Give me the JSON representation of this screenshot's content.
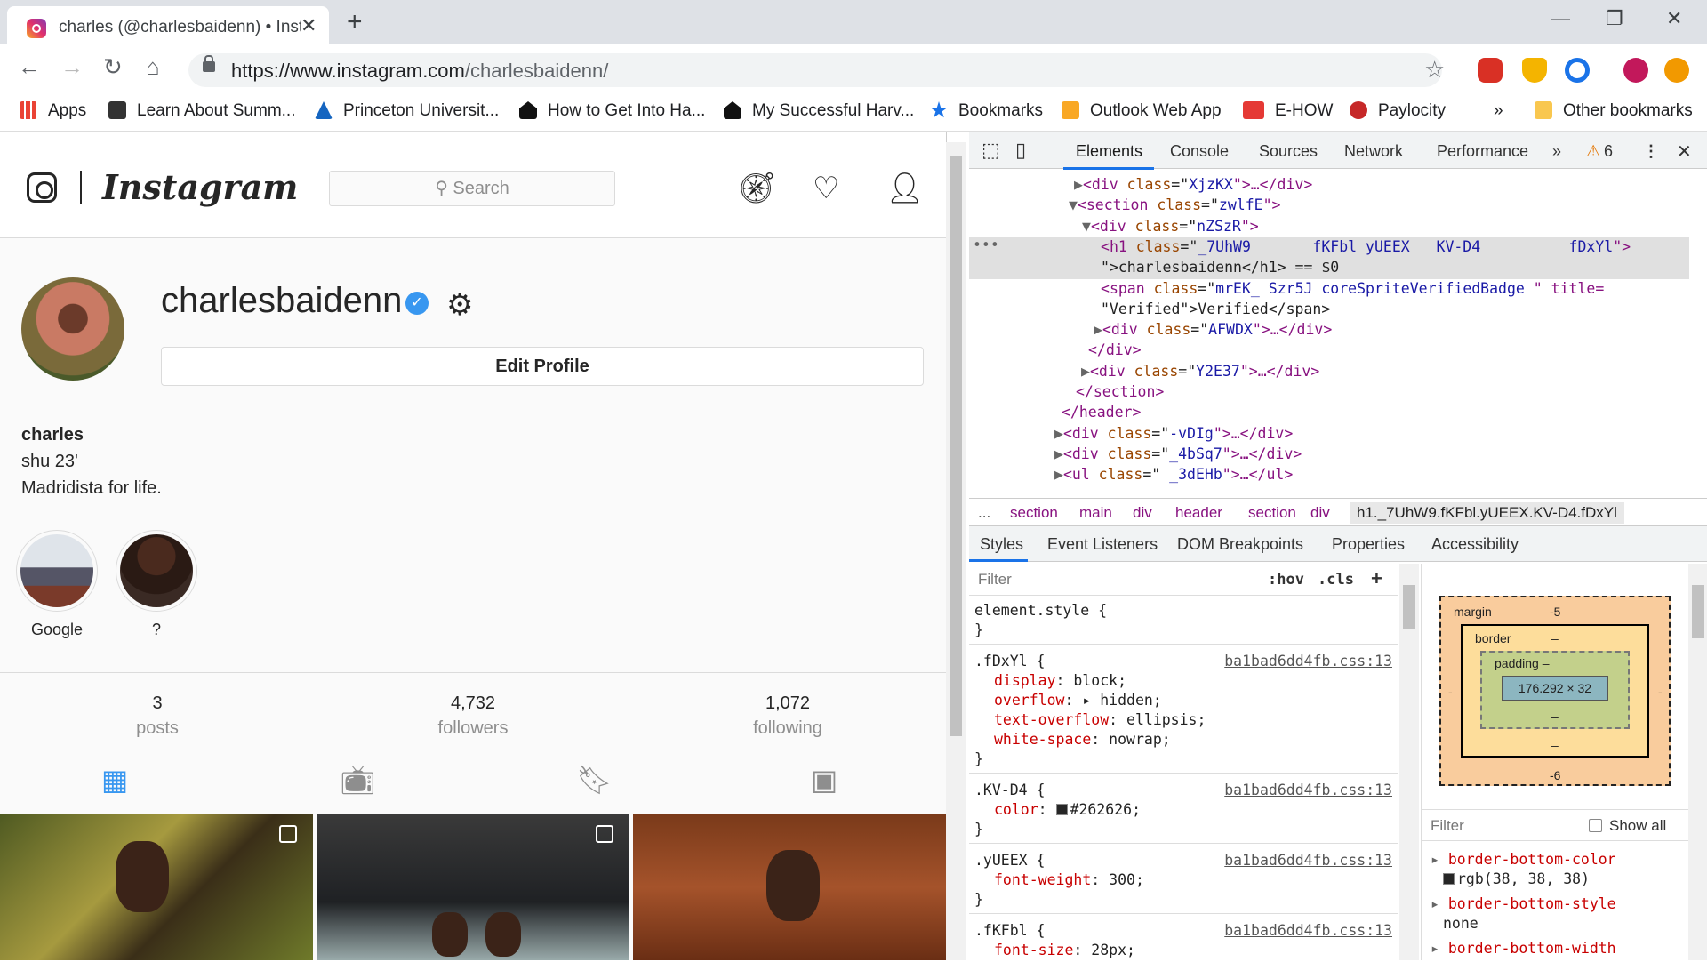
{
  "browser": {
    "tab_title": "charles (@charlesbaidenn) • Insta",
    "url_host": "https://www.instagram.com",
    "url_path": "/charlesbaidenn/",
    "bookmarks": [
      "Apps",
      "Learn About Summ...",
      "Princeton Universit...",
      "How to Get Into Ha...",
      "My Successful Harv...",
      "Bookmarks",
      "Outlook Web App",
      "E-HOW",
      "Paylocity"
    ],
    "overflow": "»",
    "other_bookmarks": "Other bookmarks"
  },
  "instagram": {
    "logo_text": "Instagram",
    "search_placeholder": "Search",
    "username": "charlesbaidenn",
    "edit_profile": "Edit Profile",
    "bio": {
      "name": "charles",
      "line1": "shu 23'",
      "line2": "Madridista for life."
    },
    "highlights": [
      {
        "label": "Google"
      },
      {
        "label": "?"
      }
    ],
    "stats": [
      {
        "value": "3",
        "label": "posts"
      },
      {
        "value": "4,732",
        "label": "followers"
      },
      {
        "value": "1,072",
        "label": "following"
      }
    ]
  },
  "devtools": {
    "tabs": [
      "Elements",
      "Console",
      "Sources",
      "Network",
      "Performance"
    ],
    "more": "»",
    "warnings": "6",
    "dom": [
      {
        "i": "▶",
        "tag": "div",
        "cls": "XjzKX",
        "tail": "…</div>"
      },
      {
        "i": "▼",
        "tag": "section",
        "cls": "zwlfE",
        "tail": ""
      },
      {
        "i": "▼",
        "tag": "div",
        "cls": "nZSzR",
        "tail": ""
      },
      {
        "i": "",
        "tag": "h1",
        "cls": "_7UhW9       fKFbl yUEEX   KV-D4          fDxYl",
        "tail": ""
      },
      {
        "raw": "\">charlesbaidenn</h1> == $0"
      },
      {
        "i": "",
        "tag": "span",
        "cls": "mrEK_ Szr5J coreSpriteVerifiedBadge ",
        "tail": " title="
      },
      {
        "raw": "\"Verified\">Verified</span>"
      },
      {
        "i": "▶",
        "tag": "div",
        "cls": "AFWDX",
        "tail": "…</div>"
      },
      {
        "raw": "</div>"
      },
      {
        "i": "▶",
        "tag": "div",
        "cls": "Y2E37",
        "tail": "…</div>"
      },
      {
        "raw": "</section>"
      },
      {
        "raw": "</header>"
      },
      {
        "i": "▶",
        "tag": "div",
        "cls": "-vDIg",
        "tail": "…</div>"
      },
      {
        "i": "▶",
        "tag": "div",
        "cls": "_4bSq7",
        "tail": "…</div>"
      },
      {
        "i": "▶",
        "tag": "ul",
        "cls": " _3dEHb",
        "tail": "…</ul>"
      }
    ],
    "breadcrumbs": [
      "...",
      "section",
      "main",
      "div",
      "header",
      "section",
      "div",
      "h1._7UhW9.fKFbl.yUEEX.KV-D4.fDxYl"
    ],
    "subtabs": [
      "Styles",
      "Event Listeners",
      "DOM Breakpoints",
      "Properties",
      "Accessibility"
    ],
    "styles_filter": "Filter",
    "hov": ":hov",
    "cls": ".cls",
    "plus": "+",
    "rules": [
      {
        "selector": "element.style {",
        "source": "",
        "props": []
      },
      {
        "selector": ".fDxYl {",
        "source": "ba1bad6dd4fb.css:13",
        "props": [
          {
            "name": "display",
            "value": "block;"
          },
          {
            "name": "overflow",
            "value": "▸ hidden;"
          },
          {
            "name": "text-overflow",
            "value": "ellipsis;"
          },
          {
            "name": "white-space",
            "value": "nowrap;"
          }
        ]
      },
      {
        "selector": ".KV-D4 {",
        "source": "ba1bad6dd4fb.css:13",
        "props": [
          {
            "name": "color",
            "value": "#262626;"
          }
        ]
      },
      {
        "selector": ".yUEEX {",
        "source": "ba1bad6dd4fb.css:13",
        "props": [
          {
            "name": "font-weight",
            "value": "300;"
          }
        ]
      },
      {
        "selector": ".fKFbl {",
        "source": "ba1bad6dd4fb.css:13",
        "props": [
          {
            "name": "font-size",
            "value": "28px;"
          }
        ]
      }
    ],
    "box_model": {
      "margin_label": "margin",
      "margin_top": "-5",
      "margin_bottom": "-6",
      "margin_side": "-",
      "border_label": "border",
      "border_val": "–",
      "padding_label": "padding –",
      "padding_val": "–",
      "content": "176.292 × 32"
    },
    "computed_filter": "Filter",
    "show_all": "Show all",
    "computed": [
      {
        "name": "border-bottom-color",
        "value": "rgb(38, 38, 38)"
      },
      {
        "name": "border-bottom-style",
        "value": "none"
      },
      {
        "name": "border-bottom-width",
        "value": ""
      }
    ]
  }
}
